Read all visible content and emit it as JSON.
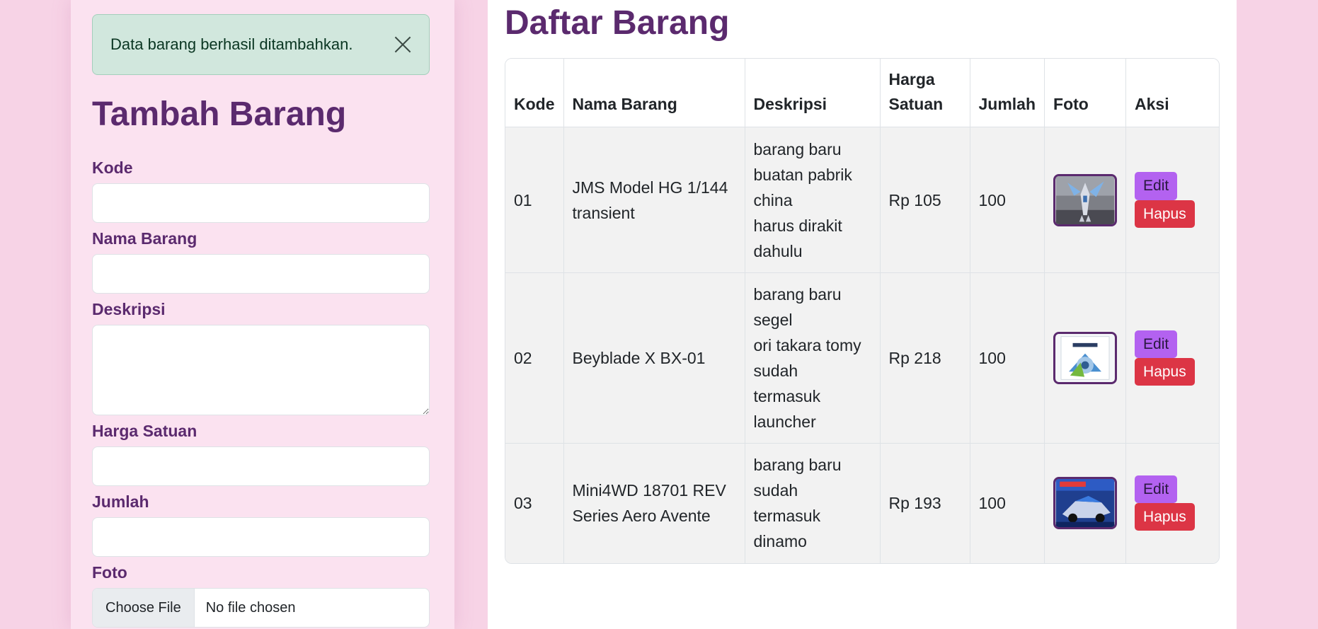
{
  "alert": {
    "message": "Data barang berhasil ditambahkan."
  },
  "form": {
    "title": "Tambah Barang",
    "kode_label": "Kode",
    "kode_value": "",
    "nama_label": "Nama Barang",
    "nama_value": "",
    "deskripsi_label": "Deskripsi",
    "deskripsi_value": "",
    "harga_label": "Harga Satuan",
    "harga_value": "",
    "jumlah_label": "Jumlah",
    "jumlah_value": "",
    "foto_label": "Foto",
    "foto_button": "Choose File",
    "foto_status": "No file chosen"
  },
  "list": {
    "title": "Daftar Barang",
    "headers": {
      "kode": "Kode",
      "nama": "Nama Barang",
      "deskripsi": "Deskripsi",
      "harga_1": "Harga",
      "harga_2": "Satuan",
      "jumlah": "Jumlah",
      "foto": "Foto",
      "aksi": "Aksi"
    },
    "rows": [
      {
        "kode": "01",
        "nama_1": "JMS Model HG 1/144",
        "nama_2": "transient",
        "desc": [
          "barang baru",
          "buatan pabrik",
          "china",
          "harus dirakit",
          "dahulu"
        ],
        "harga": "Rp 105",
        "jumlah": "100",
        "edit": "Edit",
        "hapus": "Hapus"
      },
      {
        "kode": "02",
        "nama_1": "Beyblade X BX-01",
        "nama_2": "",
        "desc": [
          "barang baru",
          "segel",
          "ori takara tomy",
          "sudah",
          "termasuk",
          "launcher"
        ],
        "harga": "Rp 218",
        "jumlah": "100",
        "edit": "Edit",
        "hapus": "Hapus"
      },
      {
        "kode": "03",
        "nama_1": "Mini4WD 18701 REV",
        "nama_2": "Series Aero Avente",
        "desc": [
          "barang baru",
          "sudah",
          "termasuk",
          "dinamo"
        ],
        "harga": "Rp 193",
        "jumlah": "100",
        "edit": "Edit",
        "hapus": "Hapus"
      }
    ]
  },
  "colors": {
    "page_bg": "#f7d3e6",
    "panel_bg": "#fbe2f0",
    "heading": "#5b2a6e",
    "alert_bg": "#d1e7dd",
    "edit_btn": "#b362f0",
    "hapus_btn": "#dc3545"
  },
  "icons": {
    "alert_close": "close-icon"
  }
}
